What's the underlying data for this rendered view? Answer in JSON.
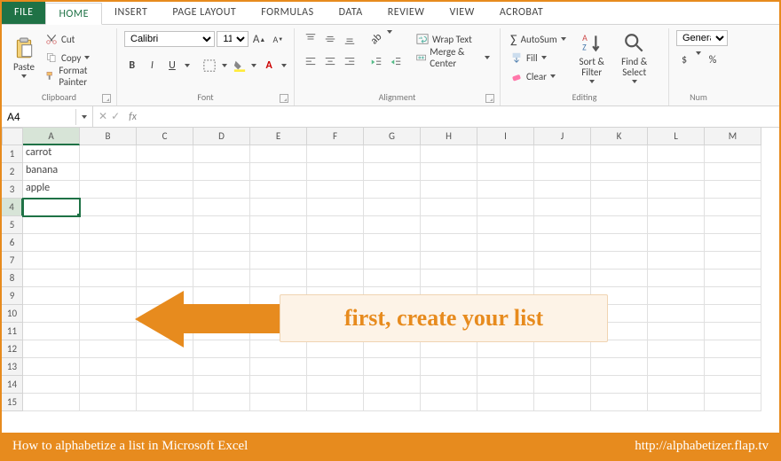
{
  "tabs": [
    "FILE",
    "HOME",
    "INSERT",
    "PAGE LAYOUT",
    "FORMULAS",
    "DATA",
    "REVIEW",
    "VIEW",
    "ACROBAT"
  ],
  "active_tab": "HOME",
  "clipboard": {
    "paste": "Paste",
    "cut": "Cut",
    "copy": "Copy",
    "fmtpaint": "Format Painter",
    "label": "Clipboard"
  },
  "font": {
    "name": "Calibri",
    "size": "11",
    "label": "Font",
    "bold": "B",
    "italic": "I",
    "underline": "U"
  },
  "align": {
    "wrap": "Wrap Text",
    "merge": "Merge & Center",
    "label": "Alignment"
  },
  "number": {
    "format": "General",
    "label": "Num"
  },
  "editing": {
    "autosum": "AutoSum",
    "fill": "Fill",
    "clear": "Clear",
    "sort": "Sort & Filter",
    "find": "Find & Select",
    "label": "Editing"
  },
  "namebox": "A4",
  "fx": "fx",
  "columns": [
    "A",
    "B",
    "C",
    "D",
    "E",
    "F",
    "G",
    "H",
    "I",
    "J",
    "K",
    "L",
    "M"
  ],
  "rows": 15,
  "active_cell": {
    "row": 4,
    "col": "A"
  },
  "cells": {
    "A1": "carrot",
    "A2": "banana",
    "A3": "apple"
  },
  "overlay_text": "first, create your list",
  "footer_left": "How to alphabetize a list in Microsoft Excel",
  "footer_right": "http://alphabetizer.flap.tv"
}
